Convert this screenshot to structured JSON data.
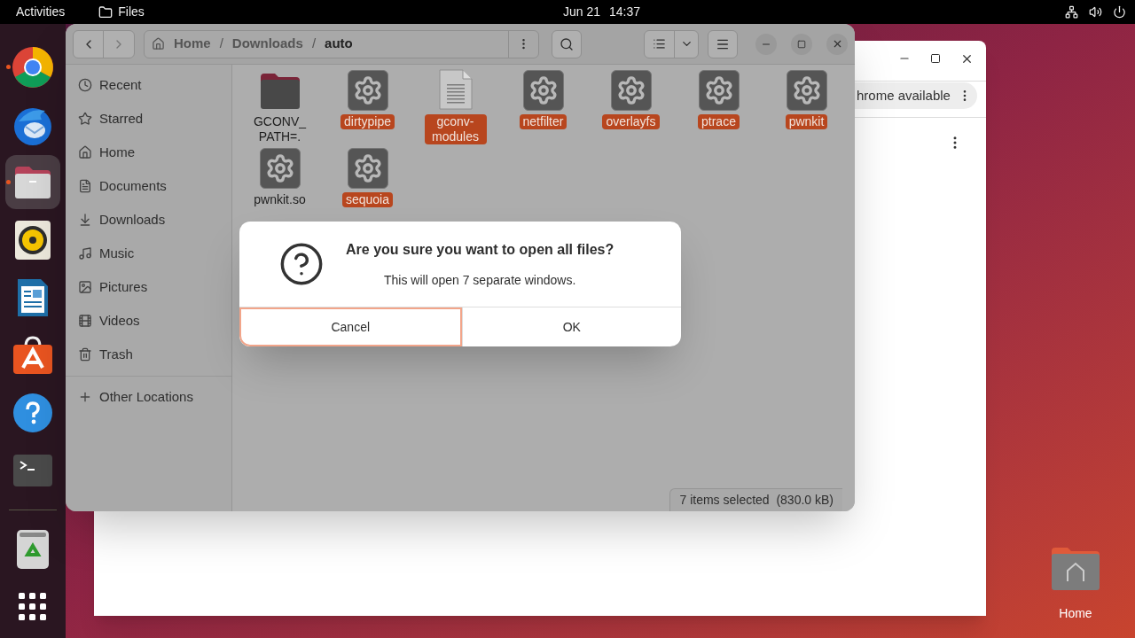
{
  "top_bar": {
    "activities": "Activities",
    "app_name": "Files",
    "date": "Jun 21",
    "time": "14:37"
  },
  "dock": [
    {
      "kind": "chrome",
      "running": true,
      "selected": false
    },
    {
      "kind": "thunderbird",
      "running": false,
      "selected": false
    },
    {
      "kind": "files",
      "running": true,
      "selected": true
    },
    {
      "kind": "rhythmbox",
      "running": false,
      "selected": false
    },
    {
      "kind": "writer",
      "running": false,
      "selected": false
    },
    {
      "kind": "appcenter",
      "running": false,
      "selected": false
    },
    {
      "kind": "help",
      "running": false,
      "selected": false
    },
    {
      "kind": "terminal",
      "running": false,
      "selected": false
    },
    {
      "kind": "trash",
      "running": false,
      "selected": false
    },
    {
      "kind": "apps",
      "running": false,
      "selected": false
    }
  ],
  "chrome_window": {
    "banner": "hrome available"
  },
  "files_window": {
    "path_separator": "/",
    "path": [
      {
        "label": "Home",
        "current": false
      },
      {
        "label": "Downloads",
        "current": false
      },
      {
        "label": "auto",
        "current": true
      }
    ],
    "sidebar": [
      {
        "kind": "recent",
        "label": "Recent"
      },
      {
        "kind": "starred",
        "label": "Starred"
      },
      {
        "kind": "home",
        "label": "Home"
      },
      {
        "kind": "documents",
        "label": "Documents"
      },
      {
        "kind": "downloads",
        "label": "Downloads"
      },
      {
        "kind": "music",
        "label": "Music"
      },
      {
        "kind": "pictures",
        "label": "Pictures"
      },
      {
        "kind": "videos",
        "label": "Videos"
      },
      {
        "kind": "trash",
        "label": "Trash"
      }
    ],
    "other_locations": "Other Locations",
    "items": [
      {
        "kind": "folder",
        "name": "GCONV_PATH=.",
        "selected": false
      },
      {
        "kind": "executable",
        "name": "dirtypipe",
        "selected": true
      },
      {
        "kind": "text",
        "name": "gconv-modules",
        "selected": true
      },
      {
        "kind": "executable",
        "name": "netfilter",
        "selected": true
      },
      {
        "kind": "executable",
        "name": "overlayfs",
        "selected": true
      },
      {
        "kind": "executable",
        "name": "ptrace",
        "selected": true
      },
      {
        "kind": "executable",
        "name": "pwnkit",
        "selected": true
      },
      {
        "kind": "executable",
        "name": "pwnkit.so",
        "selected": false
      },
      {
        "kind": "executable",
        "name": "sequoia",
        "selected": true
      }
    ],
    "status": "7 items selected  (830.0 kB)"
  },
  "dialog": {
    "title": "Are you sure you want to open all files?",
    "message": "This will open 7 separate windows.",
    "buttons": [
      {
        "label": "Cancel",
        "focused": true
      },
      {
        "label": "OK",
        "focused": false
      }
    ]
  },
  "desktop": {
    "icons": [
      {
        "label": "Home"
      }
    ]
  }
}
